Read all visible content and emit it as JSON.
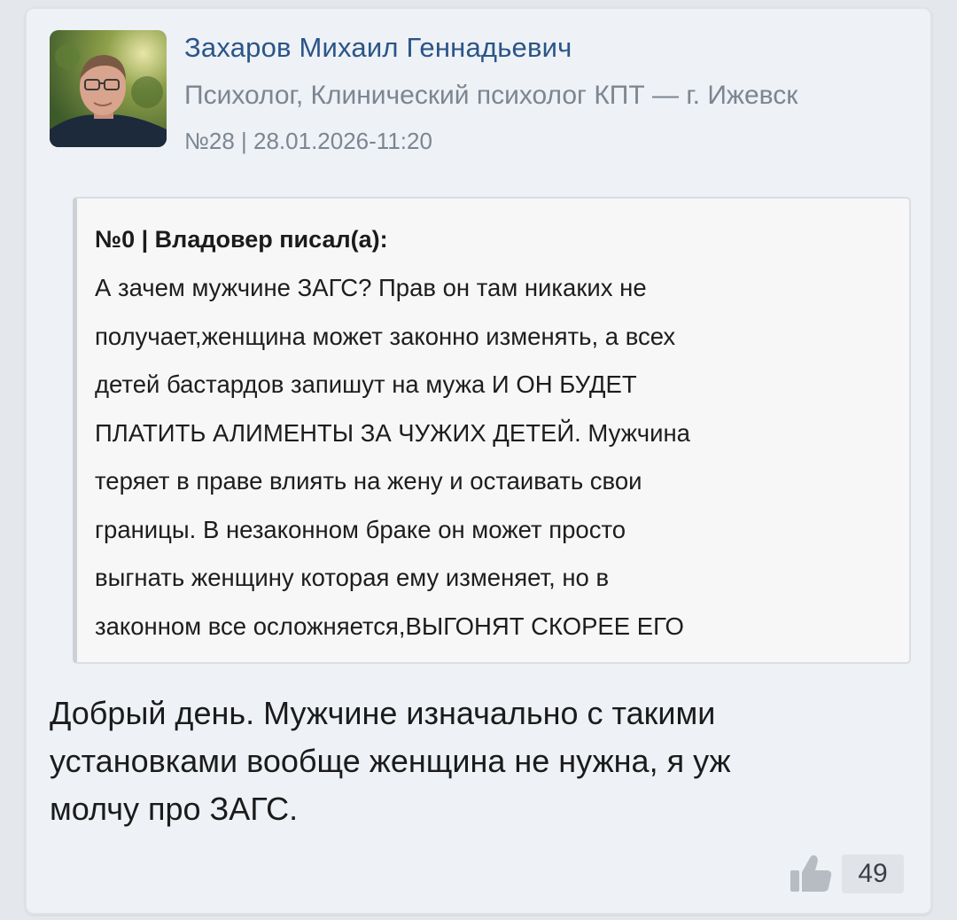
{
  "author": {
    "name": "Захаров Михаил Геннадьевич",
    "role": "Психолог, Клинический психолог КПТ — г. Ижевск",
    "meta": "№28 | 28.01.2026-11:20"
  },
  "quote": {
    "header": "№0 | Владовер писал(а):",
    "lines": [
      "А зачем мужчине ЗАГС? Прав он там никаких не",
      "получает,женщина может законно изменять, а всех",
      "детей бастардов запишут на мужа И ОН БУДЕТ",
      "ПЛАТИТЬ АЛИМЕНТЫ ЗА ЧУЖИХ ДЕТЕЙ. Мужчина",
      "теряет в праве влиять на жену и остаивать свои",
      "границы. В незаконном браке он может просто",
      "выгнать женщину которая ему изменяет, но в",
      "законном все осложняется,ВЫГОНЯТ СКОРЕЕ ЕГО"
    ]
  },
  "reply": {
    "lines": [
      "Добрый день. Мужчине изначально с такими",
      "установками вообще женщина не нужна, я уж",
      "молчу про ЗАГС."
    ]
  },
  "likes": {
    "icon": "thumbs-up-icon",
    "count": "49"
  },
  "colors": {
    "author_name": "#2a5588",
    "secondary_text": "#7c8591",
    "card_background": "#eef1f5",
    "quote_background": "#f7f7f8"
  }
}
